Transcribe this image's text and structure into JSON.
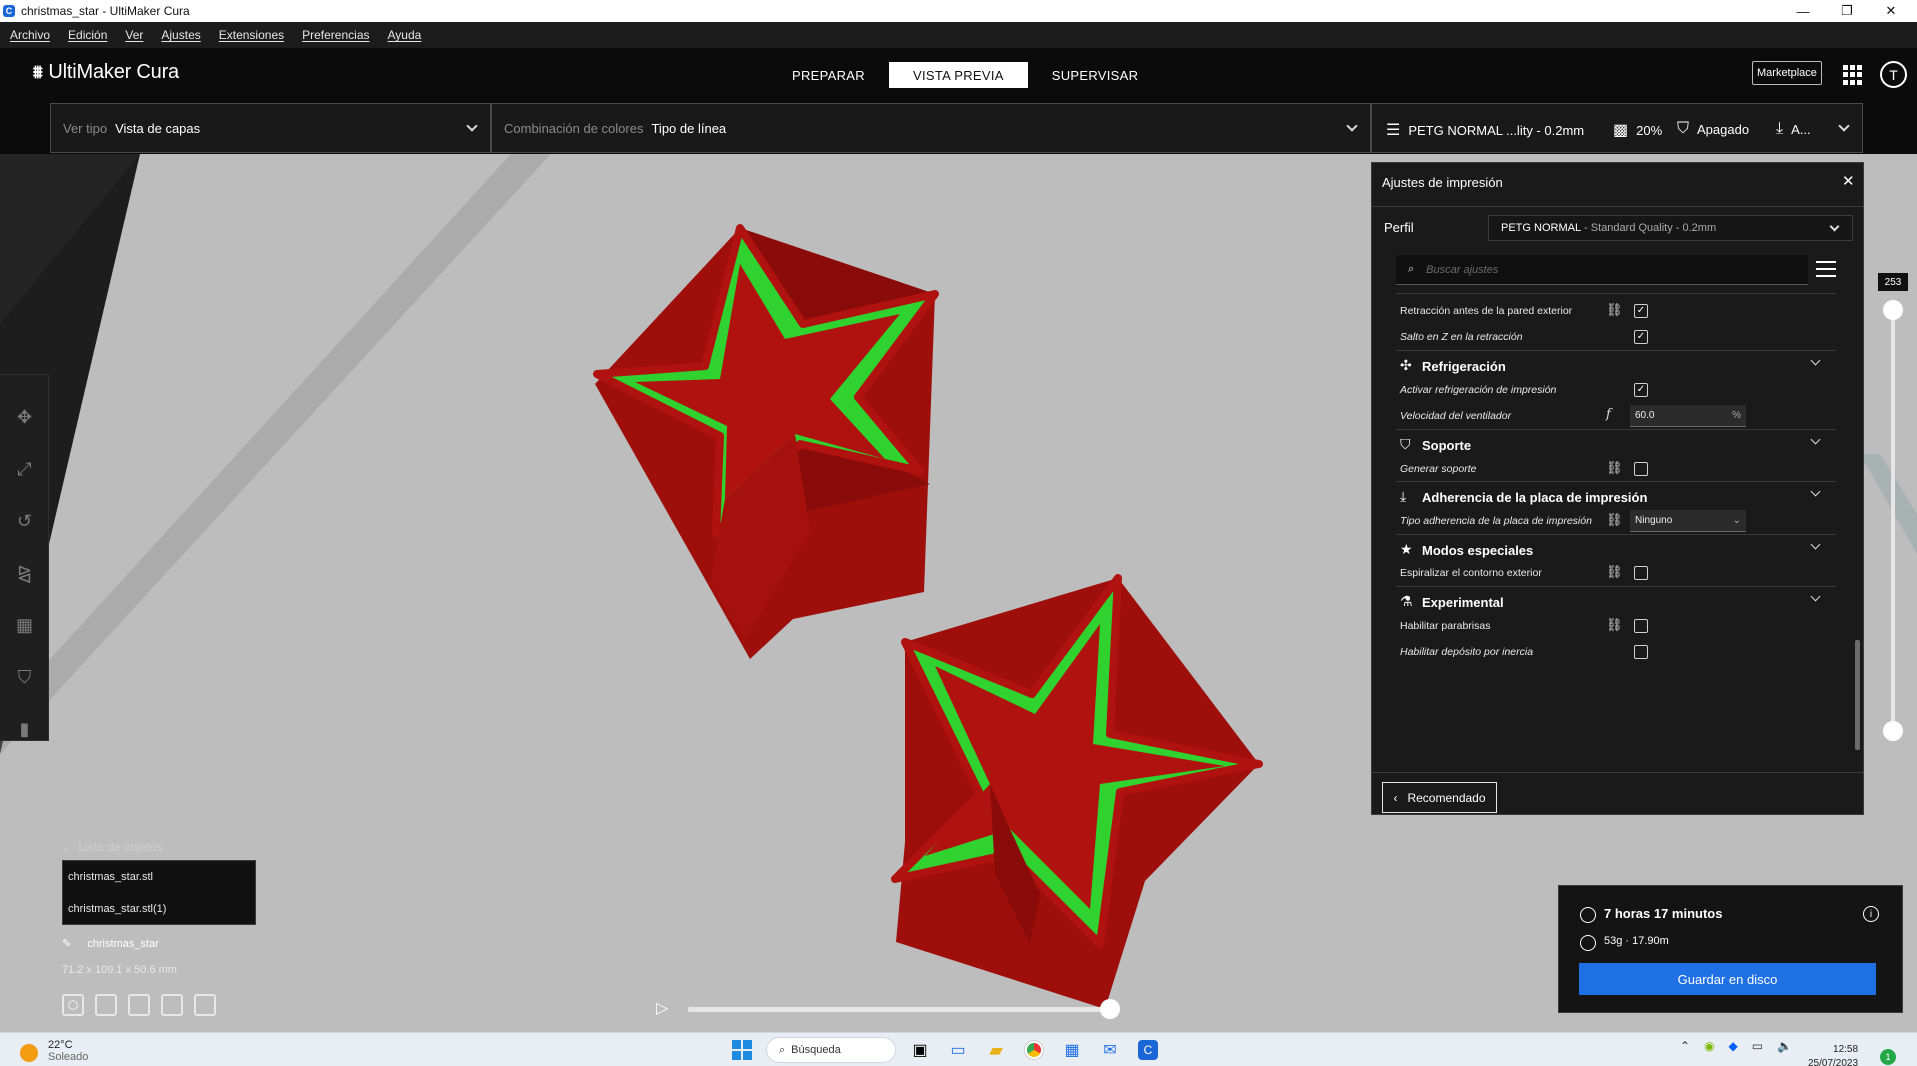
{
  "window": {
    "title": "christmas_star - UltiMaker Cura",
    "app_icon": "cura-icon"
  },
  "menu": [
    "Archivo",
    "Edición",
    "Ver",
    "Ajustes",
    "Extensiones",
    "Preferencias",
    "Ayuda"
  ],
  "header": {
    "logo": "UltiMaker Cura",
    "tabs": [
      "PREPARAR",
      "VISTA PREVIA",
      "SUPERVISAR"
    ],
    "active_tab": "VISTA PREVIA",
    "marketplace": "Marketplace",
    "user_initial": "T"
  },
  "view": {
    "type_label": "Ver tipo",
    "type_value": "Vista de capas",
    "color_label": "Combinación de colores",
    "color_value": "Tipo de línea"
  },
  "quick_settings": {
    "profile": "PETG NORMAL ...lity - 0.2mm",
    "infill": "20%",
    "support": "Apagado",
    "adhesion": "A..."
  },
  "print_settings": {
    "title": "Ajustes de impresión",
    "profile_label": "Perfil",
    "profile_name": "PETG NORMAL",
    "profile_quality": "- Standard Quality - 0.2mm",
    "search_placeholder": "Buscar ajustes",
    "rows": {
      "retract_before": "Retracción antes de la pared exterior",
      "zhop": "Salto en Z en la retracción",
      "cat_cooling": "Refrigeración",
      "enable_cooling": "Activar refrigeración de impresión",
      "fan_speed": "Velocidad del ventilador",
      "fan_value": "60.0",
      "fan_unit": "%",
      "cat_support": "Soporte",
      "gen_support": "Generar soporte",
      "cat_adhesion": "Adherencia de la placa de impresión",
      "adhesion_type": "Tipo adherencia de la placa de impresión",
      "adhesion_value": "Ninguno",
      "cat_special": "Modos especiales",
      "spiralize": "Espiralizar el contorno exterior",
      "cat_experimental": "Experimental",
      "draft_shield": "Habilitar parabrisas",
      "coasting": "Habilitar depósito por inercia"
    },
    "recommended_button": "Recomendado"
  },
  "objects": {
    "header": "Lista de objetos",
    "items": [
      "christmas_star.stl",
      "christmas_star.stl(1)"
    ],
    "name": "christmas_star",
    "dimensions": "71.2 x 109.1 x 50.6 mm"
  },
  "layer_slider": {
    "value": "253"
  },
  "estimate": {
    "time": "7 horas 17 minutos",
    "material": "53g · 17.90m",
    "save_button": "Guardar en disco"
  },
  "taskbar": {
    "temperature": "22°C",
    "weather": "Soleado",
    "search": "Búsqueda",
    "time": "12:58",
    "date": "25/07/2023",
    "notifications": "1"
  },
  "colors": {
    "accent": "#1f6fe5",
    "model_red": "#b0120f",
    "infill_green": "#2fd22f",
    "bed": "#bdbdbd"
  }
}
